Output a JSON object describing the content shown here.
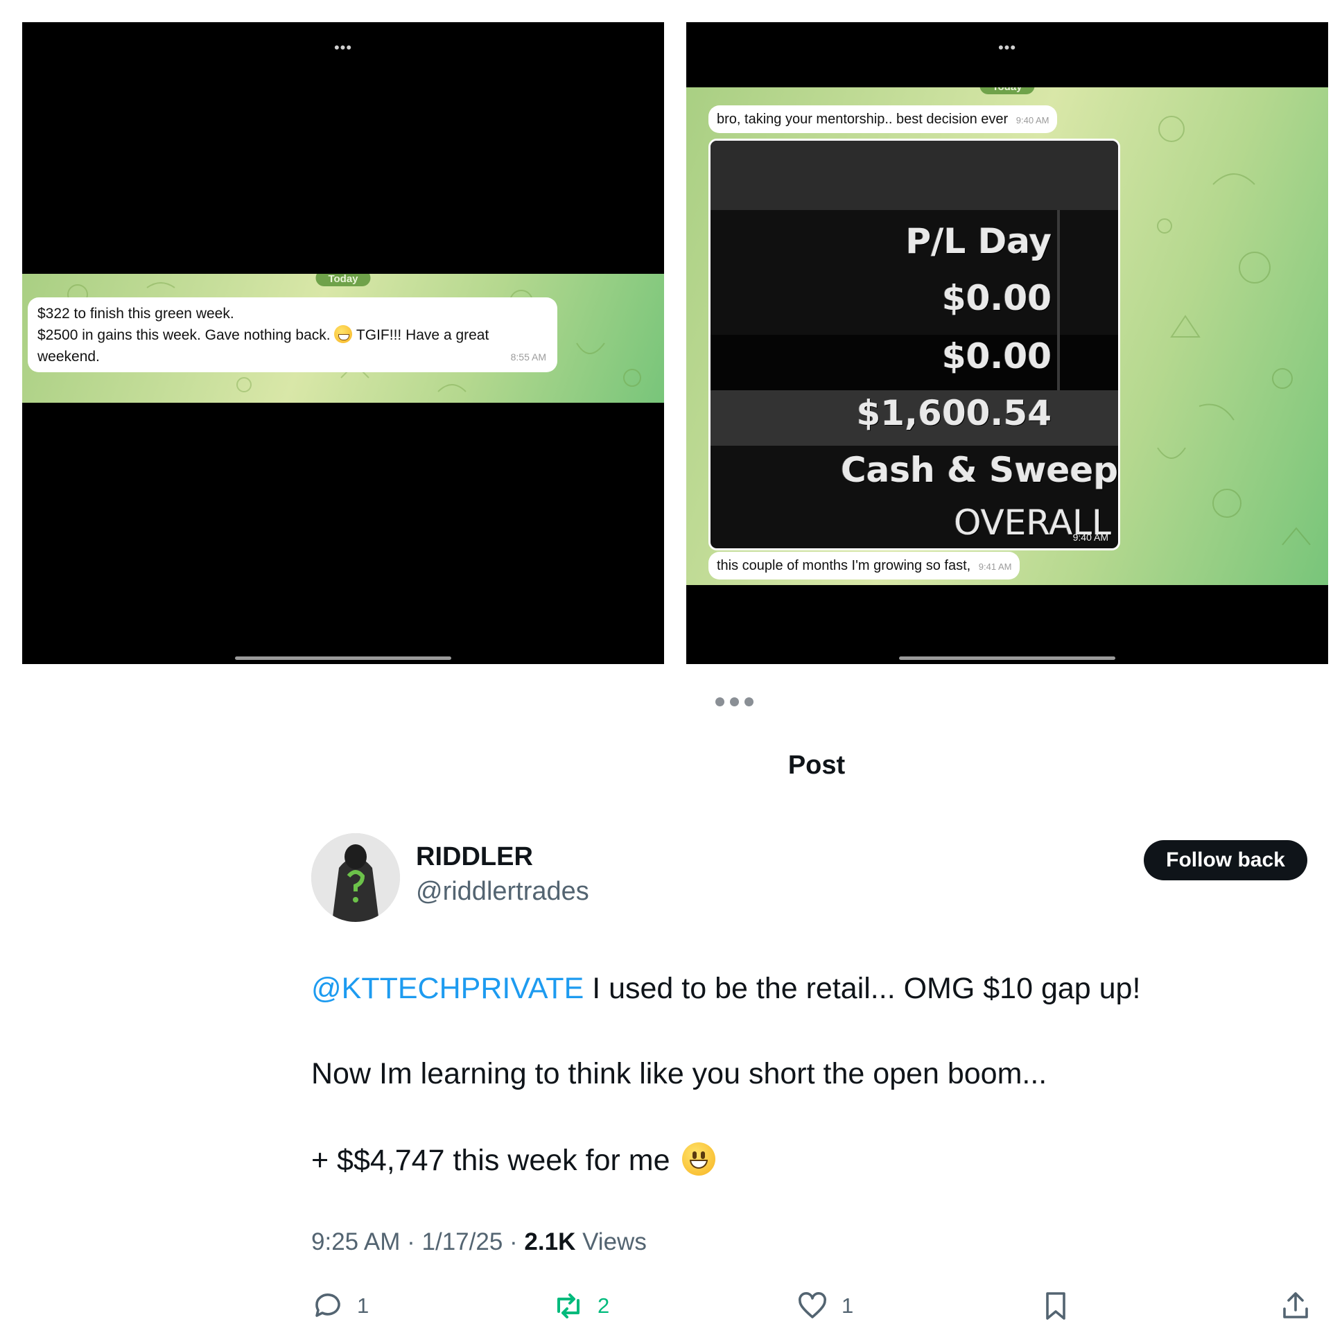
{
  "left_screenshot": {
    "date_pill": "Today",
    "message": {
      "line1": "$322 to finish this green week.",
      "line2a": "$2500 in gains this week.  Gave nothing back.",
      "line2b": "TGIF!!! Have a great",
      "line3": "weekend.",
      "time": "8:55 AM"
    }
  },
  "right_screenshot": {
    "date_pill": "Today",
    "message1": {
      "text": "bro, taking your mentorship.. best decision ever",
      "time": "9:40 AM"
    },
    "image": {
      "rows": [
        "P/L Day",
        "$0.00",
        "$0.00",
        "$1,600.54",
        "Cash & Sweep ",
        "OVERALL"
      ],
      "time": "9:40 AM"
    },
    "message2": {
      "text": "this couple of months I'm growing so fast,",
      "time": "9:41 AM"
    }
  },
  "page": {
    "title": "Post"
  },
  "author": {
    "name": "RIDDLER",
    "handle": "@riddlertrades",
    "follow_label": "Follow back"
  },
  "post": {
    "mention": "@KTTECHPRIVATE",
    "line1_rest": " I used to be the retail... OMG $10 gap up!",
    "line2": "Now Im learning to think like you short the open boom...",
    "line3": "+ $$4,747 this week for me"
  },
  "meta": {
    "time": "9:25 AM",
    "sep1": " · ",
    "date": "1/17/25",
    "sep2": " · ",
    "views_count": "2.1K",
    "views_label": " Views"
  },
  "actions": {
    "replies": "1",
    "reposts": "2",
    "likes": "1"
  },
  "colors": {
    "mention": "#1d9bf0",
    "repost": "#00ba7c",
    "text": "#0f1419",
    "muted": "#536471"
  }
}
